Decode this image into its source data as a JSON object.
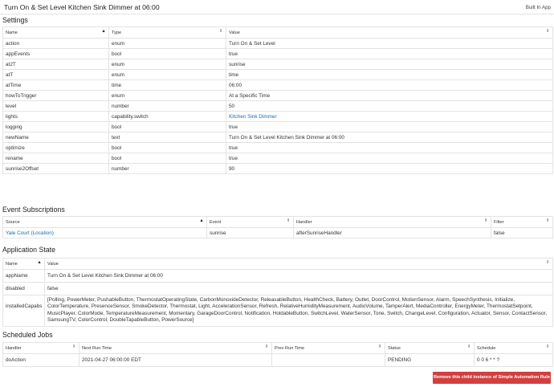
{
  "header": {
    "title": "Turn On & Set Level Kitchen Sink Dimmer at 06:00",
    "badge": "Built In App"
  },
  "settings": {
    "title": "Settings",
    "columns": [
      "Name",
      "Type",
      "Value"
    ],
    "rows": [
      {
        "name": "action",
        "type": "enum",
        "value": "Turn On & Set Level"
      },
      {
        "name": "appEvents",
        "type": "bool",
        "value": "true"
      },
      {
        "name": "at2T",
        "type": "enum",
        "value": "sunrise"
      },
      {
        "name": "atT",
        "type": "enum",
        "value": "time"
      },
      {
        "name": "atTime",
        "type": "time",
        "value": "06:00"
      },
      {
        "name": "howToTrigger",
        "type": "enum",
        "value": "At a Specific Time"
      },
      {
        "name": "level",
        "type": "number",
        "value": "50"
      },
      {
        "name": "lights",
        "type": "capability.switch",
        "value": "Kitchen Sink Dimmer"
      },
      {
        "name": "logging",
        "type": "bool",
        "value": "true"
      },
      {
        "name": "newName",
        "type": "text",
        "value": "Turn On & Set Level Kitchen Sink Dimmer at 06:00"
      },
      {
        "name": "optimize",
        "type": "bool",
        "value": "true"
      },
      {
        "name": "rename",
        "type": "bool",
        "value": "true"
      },
      {
        "name": "sunrise2Offset",
        "type": "number",
        "value": "90"
      }
    ]
  },
  "events": {
    "title": "Event Subscriptions",
    "columns": [
      "Source",
      "Event",
      "Handler",
      "Filter"
    ],
    "rows": [
      {
        "source": "Yale Court (Location)",
        "event": "sunrise",
        "handler": "afterSunriseHandler",
        "filter": "false"
      }
    ]
  },
  "state": {
    "title": "Application State",
    "columns": [
      "Name",
      "Value"
    ],
    "rows": [
      {
        "name": "appName",
        "value": "Turn On & Set Level Kitchen Sink Dimmer at 06:00"
      },
      {
        "name": "disabled",
        "value": "false"
      },
      {
        "name": "installedCapabs",
        "value": "[Polling, PowerMeter, PushableButton, ThermostatOperatingState, CarbonMonoxideDetector, ReleasableButton, HealthCheck, Battery, Outlet, DoorControl, MotionSensor, Alarm, SpeechSynthesis, Initialize, ColorTemperature, PresenceSensor, SmokeDetector, Thermostat, Light, AccelerationSensor, Refresh, RelativeHumidityMeasurement, AudioVolume, TamperAlert, MediaController, EnergyMeter, ThermostatSetpoint, MusicPlayer, ColorMode, TemperatureMeasurement, Momentary, GarageDoorControl, Notification, HoldableButton, SwitchLevel, WaterSensor, Tone, Switch, ChangeLevel, Configuration, Actuator, Sensor, ContactSensor, SamsungTV, ColorControl, DoubleTapableButton, PowerSource]"
      }
    ]
  },
  "jobs": {
    "title": "Scheduled Jobs",
    "columns": [
      "Handler",
      "Next Run Time",
      "Prev Run Time",
      "Status",
      "Schedule"
    ],
    "rows": [
      {
        "handler": "doAction",
        "next": "2021-04-27 06:00:00 EDT",
        "prev": "",
        "status": "PENDING",
        "schedule": "0 0 6 * * ?"
      }
    ]
  },
  "actions": {
    "remove_label": "Remove this child instance of Simple Automation Rule 1.1"
  },
  "sort_glyphs": {
    "asc": "▲",
    "both": "⬍"
  }
}
